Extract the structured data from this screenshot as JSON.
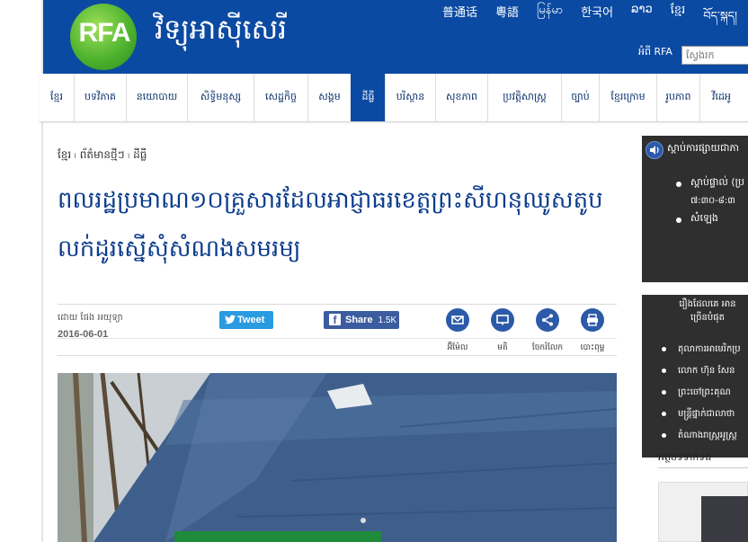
{
  "header": {
    "logo_text": "RFA",
    "site_title": "វិទ្យុអាស៊ីសេរី",
    "languages": [
      "普通话",
      "粵語",
      "မြန်မာ",
      "한국어",
      "ລາວ",
      "ខ្មែរ",
      "བོད་སྐད།"
    ],
    "about_link": "អំពី RFA",
    "search_placeholder": "ស្វែងរក"
  },
  "nav": {
    "items": [
      "ខ្មែរ",
      "បទវិភាគ",
      "នយោបាយ",
      "សិទ្ធិមនុស្ស",
      "សេដ្ឋកិច្ច",
      "សង្គម",
      "ដីធ្លី",
      "បរិស្ថាន",
      "សុខភាព",
      "ប្រវត្តិសាស្ត្រ",
      "ច្បាប់",
      "ខ្មែរក្រោម",
      "រូបភាព",
      "វីដេអូ"
    ],
    "active_index": 6
  },
  "article": {
    "breadcrumb": "ខ្មែរ ၊ ព័ត៌មានថ្មីៗ ၊ ដីធ្លី",
    "headline": "ពលរដ្ឋប្រមាណ១០គ្រួសារដែលអាជ្ញាធរខេត្តព្រះសីហនុឈូសតូបលក់ដូរស្នើសុំសំណងសមរម្យ",
    "byline": "ដោយ ផែង អយុទ្យា",
    "date": "2016-06-01",
    "tweet_label": "Tweet",
    "share_label": "Share",
    "share_count": "1.5K",
    "tools": [
      "អ៊ីម៉ែល",
      "មតិ",
      "ចែករំលែក",
      "បោះពុម្ព"
    ]
  },
  "sidebar": {
    "listen_title": "ស្ដាប់ការផ្សាយជាភា",
    "listen_items": [
      "ស្ដាប់ផ្ទាល់ (ប្រ",
      "សំឡេង"
    ],
    "listen_sub": "៧:៣០-៨:៣",
    "popular_title": "រឿងដែលគេ អានច្រើនបំផុត",
    "popular_items": [
      "តុលាការអាមេរិកប្រ",
      "លោក ហ៊ុន សែន",
      "ព្រះចៅព្រះគុណ",
      "មន្ត្រីផ្នាក់ជាលាថា",
      "តំណាងរាស្ត្រអូស្ត្រ"
    ],
    "section3_title": "អត្ថបទទាក់ទង"
  },
  "colors": {
    "brand_blue": "#0b4aa2",
    "headline_blue": "#0b3c8c",
    "sidebar_dark": "#2f2f2f"
  }
}
